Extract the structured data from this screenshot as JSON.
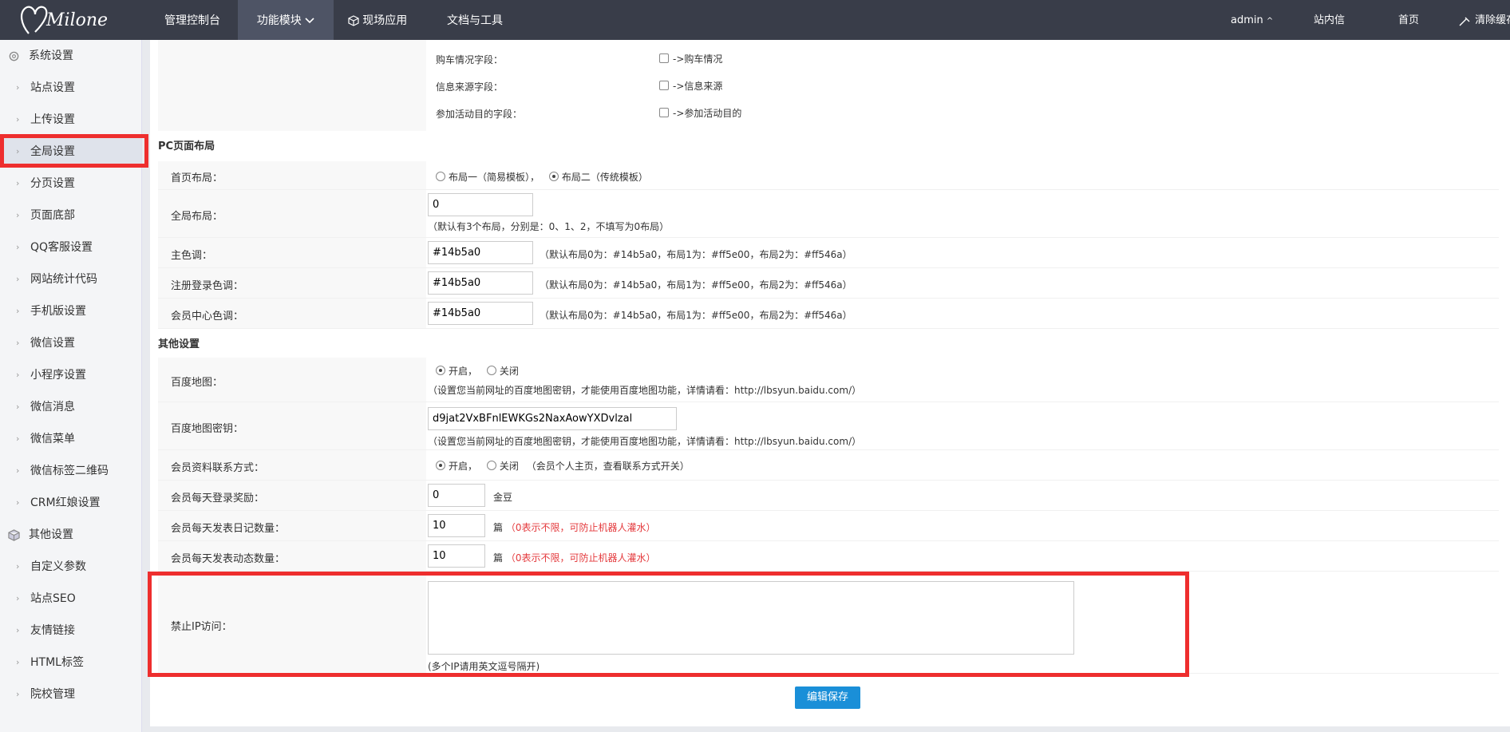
{
  "topbar": {
    "logo_text": "Milone",
    "nav": [
      "管理控制台",
      "功能模块",
      "现场应用",
      "文档与工具"
    ],
    "user": "admin",
    "links": [
      "站内信",
      "首页",
      "清除缓存"
    ]
  },
  "sidebar": {
    "group1": "系统设置",
    "items1": [
      "站点设置",
      "上传设置",
      "全局设置",
      "分页设置",
      "页面底部",
      "QQ客服设置",
      "网站统计代码",
      "手机版设置",
      "微信设置",
      "小程序设置",
      "微信消息",
      "微信菜单",
      "微信标签二维码",
      "CRM红娘设置"
    ],
    "group2": "其他设置",
    "items2": [
      "自定义参数",
      "站点SEO",
      "友情链接",
      "HTML标签",
      "院校管理"
    ]
  },
  "form": {
    "field_rows": [
      {
        "label": "购车情况字段：",
        "check": "->购车情况"
      },
      {
        "label": "信息来源字段：",
        "check": "->信息来源"
      },
      {
        "label": "参加活动目的字段：",
        "check": "->参加活动目的"
      }
    ],
    "sec_pc": "PC页面布局",
    "home_layout": {
      "label": "首页布局：",
      "opt1": "布局一（简易模板），",
      "opt2": "布局二（传统模板）"
    },
    "global_layout": {
      "label": "全局布局：",
      "value": "0",
      "hint": "（默认有3个布局，分别是：0、1、2，不填写为0布局）"
    },
    "main_color": {
      "label": "主色调：",
      "value": "#14b5a0",
      "hint": "（默认布局0为：#14b5a0，布局1为：#ff5e00，布局2为：#ff546a）"
    },
    "reg_color": {
      "label": "注册登录色调：",
      "value": "#14b5a0",
      "hint": "（默认布局0为：#14b5a0，布局1为：#ff5e00，布局2为：#ff546a）"
    },
    "member_color": {
      "label": "会员中心色调：",
      "value": "#14b5a0",
      "hint": "（默认布局0为：#14b5a0，布局1为：#ff5e00，布局2为：#ff546a）"
    },
    "sec_other": "其他设置",
    "baidu_map": {
      "label": "百度地图：",
      "on": "开启，",
      "off": "关闭",
      "hint": "（设置您当前网址的百度地图密钥，才能使用百度地图功能，详情请看：http://lbsyun.baidu.com/）"
    },
    "baidu_key": {
      "label": "百度地图密钥：",
      "value": "d9jat2VxBFnlEWKGs2NaxAowYXDvlzal",
      "hint": "（设置您当前网址的百度地图密钥，才能使用百度地图功能，详情请看：http://lbsyun.baidu.com/）"
    },
    "contact": {
      "label": "会员资料联系方式：",
      "on": "开启，",
      "off": "关闭",
      "hint": "（会员个人主页，查看联系方式开关）"
    },
    "login_reward": {
      "label": "会员每天登录奖励：",
      "value": "0",
      "unit": "金豆"
    },
    "diary_limit": {
      "label": "会员每天发表日记数量：",
      "value": "10",
      "unit": "篇",
      "hint": "（0表示不限，可防止机器人灌水）"
    },
    "dynamic_limit": {
      "label": "会员每天发表动态数量：",
      "value": "10",
      "unit": "篇",
      "hint": "（0表示不限，可防止机器人灌水）"
    },
    "ban_ip": {
      "label": "禁止IP访问：",
      "value": "",
      "hint": "(多个IP请用英文逗号隔开)"
    },
    "save": "编辑保存"
  }
}
